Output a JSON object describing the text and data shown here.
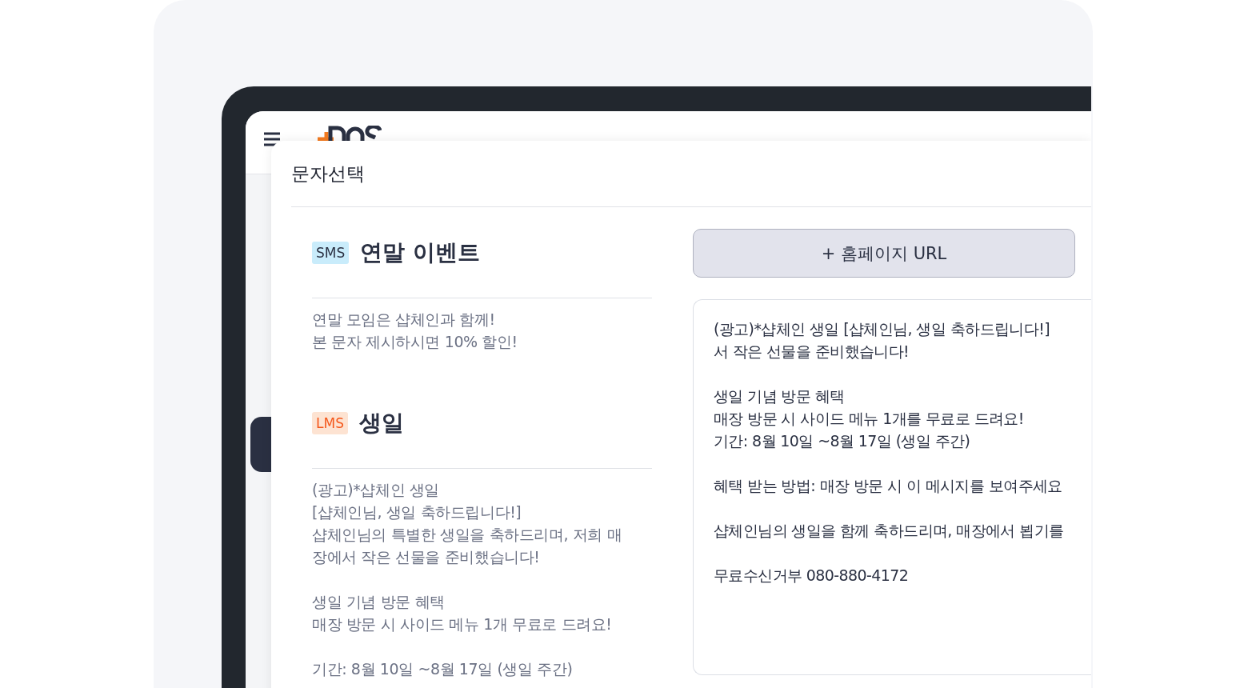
{
  "modal": {
    "title": "문자선택",
    "templates": [
      {
        "kind": "sms",
        "badge": "SMS",
        "title": "연말 이벤트",
        "body": [
          [
            "연말 모임은 샵체인과 함께!",
            "본 문자 제시하시면 10% 할인!"
          ]
        ]
      },
      {
        "kind": "lms",
        "badge": "LMS",
        "title": "생일",
        "body": [
          [
            "(광고)*샵체인 생일",
            "[샵체인님, 생일 축하드립니다!]",
            "샵체인님의 특별한 생일을 축하드리며, 저희 매",
            "장에서 작은 선물을 준비했습니다!"
          ],
          [
            "생일 기념 방문 혜택",
            "매장 방문 시 사이드 메뉴 1개 무료로 드려요!"
          ],
          [
            "기간: 8월 10일 ~8월 17일 (생일 주간)"
          ]
        ]
      }
    ],
    "url_button": "+ 홈페이지 URL",
    "preview": [
      [
        "(광고)*샵체인 생일 [샵체인님, 생일 축하드립니다!]",
        "서 작은 선물을 준비했습니다!"
      ],
      [
        "생일 기념 방문 혜택",
        "매장 방문 시 사이드 메뉴 1개를 무료로 드려요!",
        "기간: 8월 10일 ~8월 17일 (생일 주간)"
      ],
      [
        "혜택 받는 방법: 매장 방문 시 이 메시지를 보여주세요"
      ],
      [
        "샵체인님의 생일을 함께 축하드리며, 매장에서 뵙기를"
      ],
      [
        "무료수신거부 080-880-4172"
      ]
    ]
  }
}
